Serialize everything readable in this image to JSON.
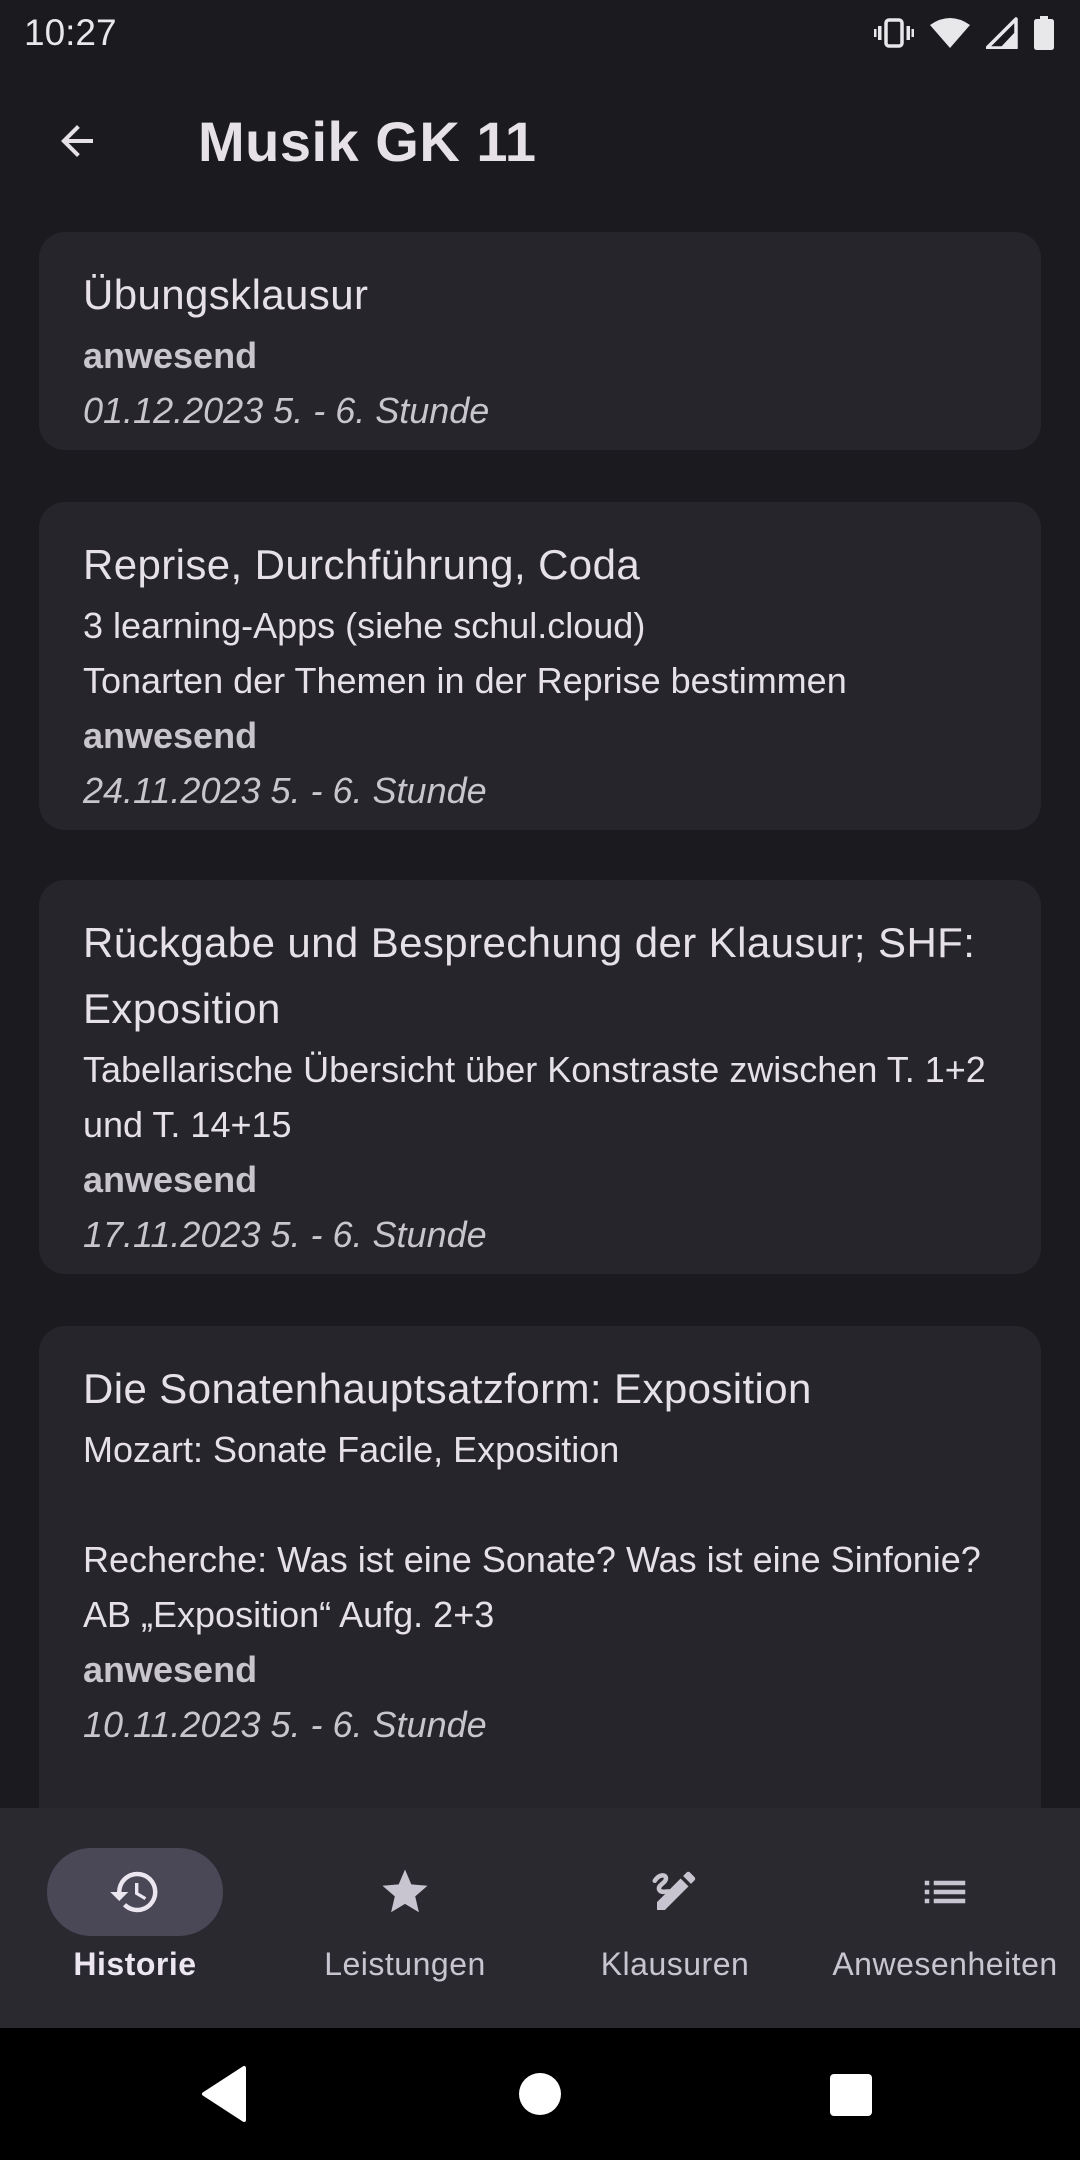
{
  "status_bar": {
    "time": "10:27",
    "icons": [
      "vibrate-icon",
      "wifi-icon",
      "signal-icon",
      "battery-icon"
    ]
  },
  "app_bar": {
    "title": "Musik GK 11",
    "back_icon": "arrow-back-icon"
  },
  "lessons": [
    {
      "title": "Übungsklausur",
      "description": "",
      "status": "anwesend",
      "date": "01.12.2023  5. - 6. Stunde"
    },
    {
      "title": "Reprise, Durchführung, Coda",
      "description": "3 learning-Apps (siehe schul.cloud)\nTonarten der Themen in der Reprise bestimmen",
      "status": "anwesend",
      "date": "24.11.2023  5. - 6. Stunde"
    },
    {
      "title": "Rückgabe und Besprechung der Klausur; SHF: Exposition",
      "description": "Tabellarische Übersicht über Konstraste zwischen T. 1+2 und T. 14+15",
      "status": "anwesend",
      "date": "17.11.2023  5. - 6. Stunde"
    },
    {
      "title": "Die Sonatenhauptsatzform: Exposition",
      "description": "Mozart: Sonate Facile, Exposition\n\nRecherche: Was ist eine Sonate? Was ist eine Sinfonie?\nAB „Exposition“ Aufg. 2+3",
      "status": "anwesend",
      "date": "10.11.2023  5. - 6. Stunde"
    }
  ],
  "bottom_nav": {
    "active": "Historie",
    "items": [
      {
        "label": "Historie",
        "icon": "history-icon"
      },
      {
        "label": "Leistungen",
        "icon": "star-icon"
      },
      {
        "label": "Klausuren",
        "icon": "edit-pen-icon"
      },
      {
        "label": "Anwesenheiten",
        "icon": "list-icon"
      }
    ]
  },
  "system_nav": {
    "icons": [
      "back-triangle-icon",
      "home-circle-icon",
      "recents-square-icon"
    ]
  },
  "colors": {
    "background": "#1b1b1f",
    "card": "#25252b",
    "nav_bar": "#2a2930",
    "active_pill": "#4a4757"
  }
}
